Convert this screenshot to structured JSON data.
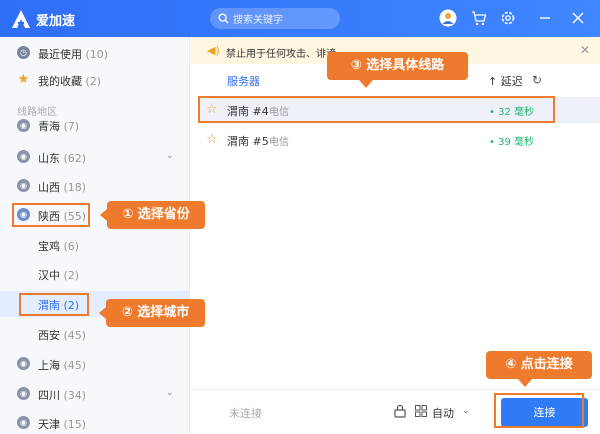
{
  "app": {
    "name": "爱加速"
  },
  "search": {
    "placeholder": "搜索关键字"
  },
  "sidebar": {
    "top_items": [
      {
        "label": "最近使用",
        "count": "(10)"
      },
      {
        "label": "我的收藏",
        "count": "(2)"
      }
    ],
    "section_label": "线路地区",
    "regions": [
      {
        "label": "青海",
        "count": "(7)"
      },
      {
        "label": "山东",
        "count": "(62)"
      },
      {
        "label": "山西",
        "count": "(18)"
      },
      {
        "label": "陕西",
        "count": "(55)"
      },
      {
        "label": "宝鸡",
        "count": "(6)"
      },
      {
        "label": "汉中",
        "count": "(2)"
      },
      {
        "label": "渭南",
        "count": "(2)"
      },
      {
        "label": "西安",
        "count": "(45)"
      },
      {
        "label": "上海",
        "count": "(45)"
      },
      {
        "label": "四川",
        "count": "(34)"
      },
      {
        "label": "天津",
        "count": "(15)"
      }
    ]
  },
  "notice": {
    "text": "禁止用于任何攻击、诽谤、…"
  },
  "columns": {
    "server": "服务器",
    "delay": "↑ 延迟"
  },
  "servers": [
    {
      "name": "渭南 #4",
      "isp": "电信",
      "latency": "• 32 毫秒"
    },
    {
      "name": "渭南 #5",
      "isp": "电信",
      "latency": "• 39 毫秒"
    }
  ],
  "footer": {
    "status": "未连接",
    "mode": "自动",
    "connect_label": "连接"
  },
  "annotations": {
    "step1": "① 选择省份",
    "step2": "② 选择城市",
    "step3": "③ 选择具体线路",
    "step4": "④ 点击连接"
  },
  "colors": {
    "brand": "#2f6ef6",
    "accent": "#ee7a2e",
    "latency": "#22b573"
  }
}
